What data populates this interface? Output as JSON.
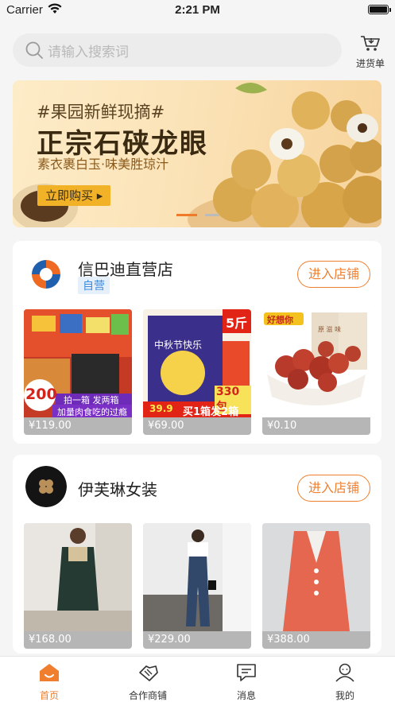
{
  "status_bar": {
    "carrier": "Carrier",
    "time": "2:21 PM"
  },
  "search": {
    "placeholder": "请输入搜索词"
  },
  "cart": {
    "label": "进货单"
  },
  "banner": {
    "tag": "#果园新鲜现摘#",
    "title": "正宗石硖龙眼",
    "subtitle": "素衣裹白玉·味美胜琼汁",
    "button": "立即购买 ▸",
    "page_count": 2,
    "current_page": 1
  },
  "stores": [
    {
      "name": "信巴迪直营店",
      "badge": "自营",
      "enter_label": "进入店铺",
      "products": [
        {
          "price": "¥119.00",
          "stamp": "200",
          "promo": "拍一箱 发两箱",
          "caption": "加量肉食吃的过瘾"
        },
        {
          "price": "¥69.00",
          "weight": "5斤",
          "title": "中秋节快乐",
          "count": "330包",
          "promo": "买1箱发2箱",
          "price_tag": "39.9"
        },
        {
          "price": "¥0.10",
          "brand": "好想你",
          "pack_label": "原 滋 味"
        }
      ]
    },
    {
      "name": "伊芙琳女装",
      "enter_label": "进入店铺",
      "products": [
        {
          "price": "¥168.00"
        },
        {
          "price": "¥229.00"
        },
        {
          "price": "¥388.00"
        }
      ]
    }
  ],
  "tabbar": {
    "items": [
      {
        "label": "首页",
        "icon": "home-icon",
        "active": true
      },
      {
        "label": "合作商铺",
        "icon": "handshake-icon",
        "active": false
      },
      {
        "label": "消息",
        "icon": "message-icon",
        "active": false
      },
      {
        "label": "我的",
        "icon": "profile-icon",
        "active": false
      }
    ]
  },
  "colors": {
    "accent": "#ef7f2e",
    "badge_blue": "#3d8be0",
    "background": "#f5f5f5"
  }
}
